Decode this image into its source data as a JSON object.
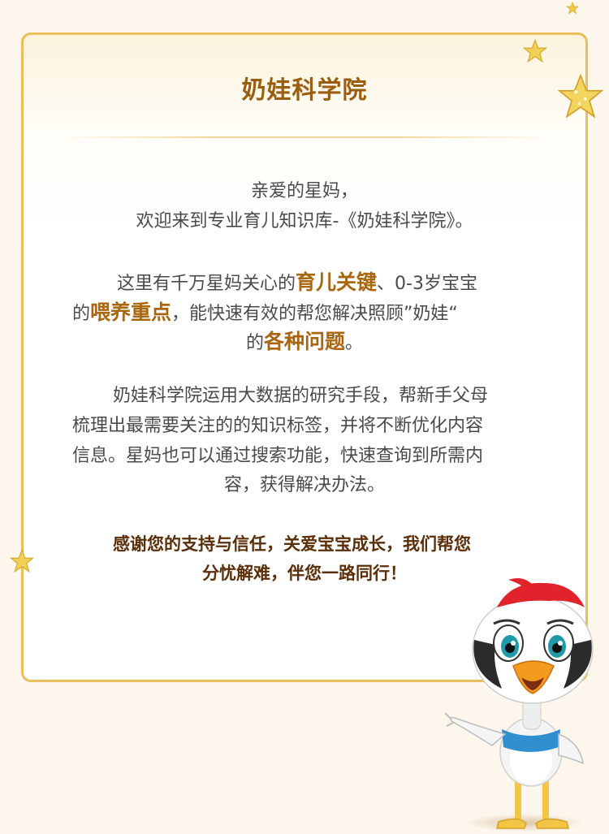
{
  "title": "奶娃科学院",
  "greeting": {
    "line1": "亲爱的星妈，",
    "line2": "欢迎来到专业育儿知识库-《奶娃科学院》。"
  },
  "para1": {
    "a": "这里有千万星妈关心的",
    "b": "育儿关键",
    "c": "、0-3岁宝宝",
    "d": "的",
    "e": "喂养重点",
    "f": "，能快速有效的帮您解决照顾”奶娃“",
    "g": "的",
    "h": "各种问题",
    "i": "。"
  },
  "para2": {
    "line1": "奶娃科学院运用大数据的研究手段，帮新手父母",
    "line2": "梳理出最需要关注的的知识标签，并将不断优化内容",
    "line3": "信息。星妈也可以通过搜索功能，快速查询到所需内",
    "line4": "容，获得解决办法。"
  },
  "closing": {
    "line1": "感谢您的支持与信任，关爱宝宝成长，我们帮您",
    "line2": "分忧解难，伴您一路同行！"
  },
  "colors": {
    "accent": "#a8660e",
    "border": "#e9bf5e",
    "star": "#f0c94a"
  },
  "icons": [
    "star-icon",
    "mascot-bird"
  ]
}
